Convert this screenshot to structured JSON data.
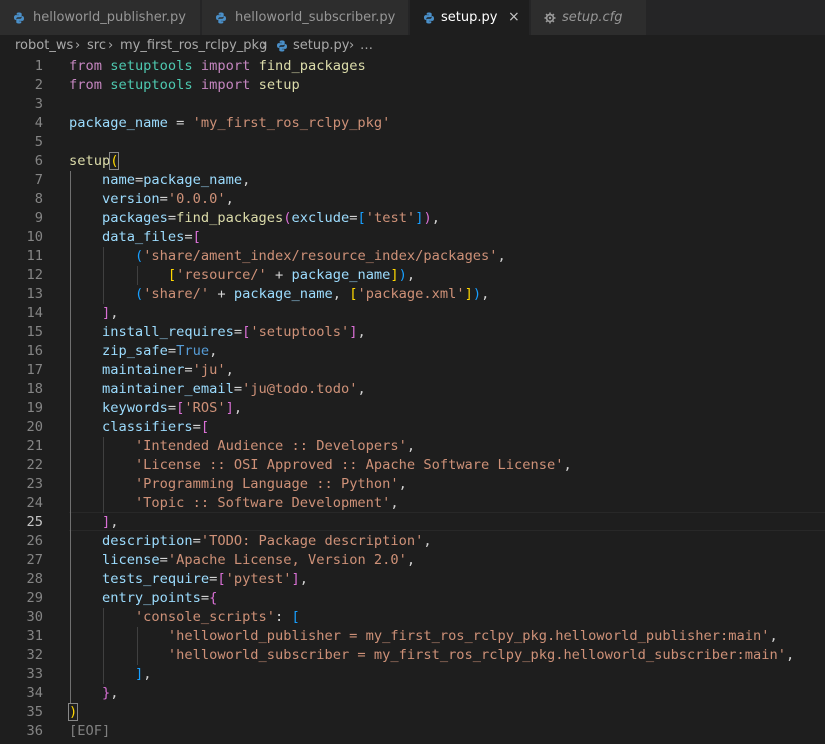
{
  "tabs": [
    {
      "label": "helloworld_publisher.py",
      "icon": "python-icon",
      "active": false
    },
    {
      "label": "helloworld_subscriber.py",
      "icon": "python-icon",
      "active": false
    },
    {
      "label": "setup.py",
      "icon": "python-icon",
      "active": true,
      "close": "×"
    },
    {
      "label": "setup.cfg",
      "icon": "gear-icon",
      "active": false,
      "italic": true
    }
  ],
  "breadcrumb": {
    "items": [
      "robot_ws",
      "src",
      "my_first_ros_rclpy_pkg",
      "setup.py",
      "…"
    ],
    "separator": "›"
  },
  "editor": {
    "current_line": 25,
    "lines": [
      {
        "n": "1"
      },
      {
        "n": "2"
      },
      {
        "n": "3"
      },
      {
        "n": "4"
      },
      {
        "n": "5"
      },
      {
        "n": "6"
      },
      {
        "n": "7"
      },
      {
        "n": "8"
      },
      {
        "n": "9"
      },
      {
        "n": "10"
      },
      {
        "n": "11"
      },
      {
        "n": "12"
      },
      {
        "n": "13"
      },
      {
        "n": "14"
      },
      {
        "n": "15"
      },
      {
        "n": "16"
      },
      {
        "n": "17"
      },
      {
        "n": "18"
      },
      {
        "n": "19"
      },
      {
        "n": "20"
      },
      {
        "n": "21"
      },
      {
        "n": "22"
      },
      {
        "n": "23"
      },
      {
        "n": "24"
      },
      {
        "n": "25"
      },
      {
        "n": "26"
      },
      {
        "n": "27"
      },
      {
        "n": "28"
      },
      {
        "n": "29"
      },
      {
        "n": "30"
      },
      {
        "n": "31"
      },
      {
        "n": "32"
      },
      {
        "n": "33"
      },
      {
        "n": "34"
      },
      {
        "n": "35"
      },
      {
        "n": "36"
      }
    ],
    "tokens": {
      "from": "from",
      "import": "import",
      "setuptools": "setuptools",
      "find_packages": "find_packages",
      "setup": "setup",
      "package_name": "package_name",
      "eq": " = ",
      "pkg_str": "'my_first_ros_rclpy_pkg'",
      "name_kw": "name",
      "version_kw": "version",
      "version_str": "'0.0.0'",
      "packages_kw": "packages",
      "exclude_kw": "exclude",
      "test_str": "'test'",
      "data_files_kw": "data_files",
      "share_index_str": "'share/ament_index/resource_index/packages'",
      "resource_str": "'resource/'",
      "share_str": "'share/'",
      "package_xml_str": "'package.xml'",
      "install_requires_kw": "install_requires",
      "setuptools_str": "'setuptools'",
      "zip_safe_kw": "zip_safe",
      "true_const": "True",
      "maintainer_kw": "maintainer",
      "ju_str": "'ju'",
      "maintainer_email_kw": "maintainer_email",
      "email_str": "'ju@todo.todo'",
      "keywords_kw": "keywords",
      "ros_str": "'ROS'",
      "classifiers_kw": "classifiers",
      "cls1": "'Intended Audience :: Developers'",
      "cls2": "'License :: OSI Approved :: Apache Software License'",
      "cls3": "'Programming Language :: Python'",
      "cls4": "'Topic :: Software Development'",
      "description_kw": "description",
      "desc_str": "'TODO: Package description'",
      "license_kw": "license",
      "license_str": "'Apache License, Version 2.0'",
      "tests_require_kw": "tests_require",
      "pytest_str": "'pytest'",
      "entry_points_kw": "entry_points",
      "console_scripts_str": "'console_scripts'",
      "ep1": "'helloworld_publisher = my_first_ros_rclpy_pkg.helloworld_publisher:main'",
      "ep2": "'helloworld_subscriber = my_first_ros_rclpy_pkg.helloworld_subscriber:main'",
      "eof": "[EOF]"
    }
  }
}
